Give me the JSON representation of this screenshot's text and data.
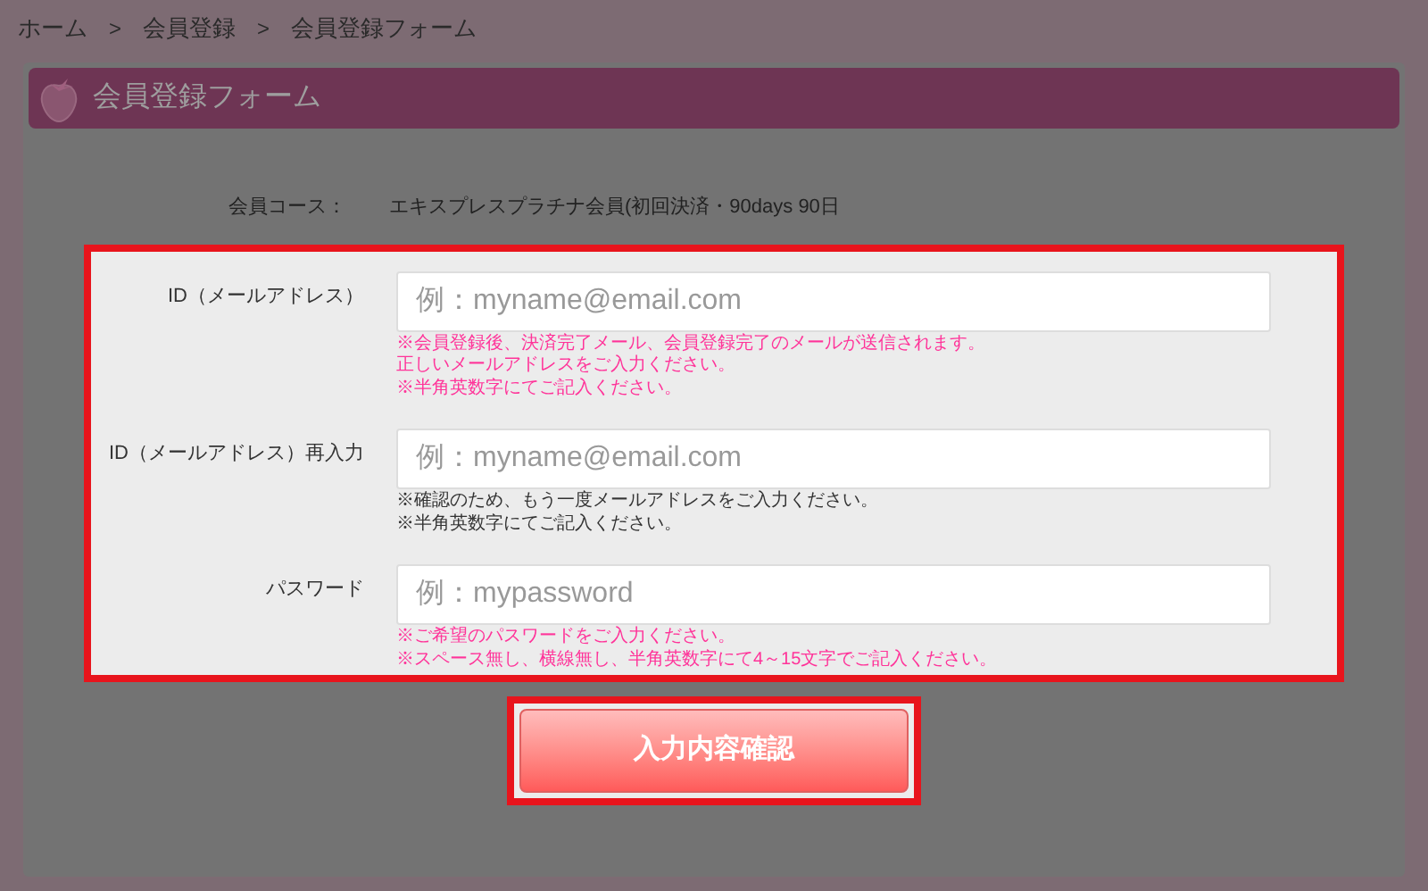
{
  "breadcrumb": [
    "ホーム",
    "会員登録",
    "会員登録フォーム"
  ],
  "breadcrumb_separator": ">",
  "form_title": "会員登録フォーム",
  "course": {
    "label": "会員コース：",
    "value": "エキスプレスプラチナ会員(初回決済・90days 90日"
  },
  "fields": [
    {
      "label": "ID（メールアドレス）",
      "placeholder": "例：myname@email.com",
      "notes": [
        {
          "kind": "warning",
          "text": "※会員登録後、決済完了メール、会員登録完了のメールが送信されます。"
        },
        {
          "kind": "warning",
          "text": "正しいメールアドレスをご入力ください。"
        },
        {
          "kind": "warning",
          "text": "※半角英数字にてご記入ください。"
        }
      ]
    },
    {
      "label": "ID（メールアドレス）再入力",
      "placeholder": "例：myname@email.com",
      "notes": [
        {
          "kind": "info",
          "text": "※確認のため、もう一度メールアドレスをご入力ください。"
        },
        {
          "kind": "info",
          "text": "※半角英数字にてご記入ください。"
        }
      ]
    },
    {
      "label": "パスワード",
      "placeholder": "例：mypassword",
      "notes": [
        {
          "kind": "warning",
          "text": "※ご希望のパスワードをご入力ください。"
        },
        {
          "kind": "warning",
          "text": "※スペース無し、横線無し、半角英数字にて4～15文字でご記入ください。"
        }
      ]
    }
  ],
  "submit_button": "入力内容確認"
}
